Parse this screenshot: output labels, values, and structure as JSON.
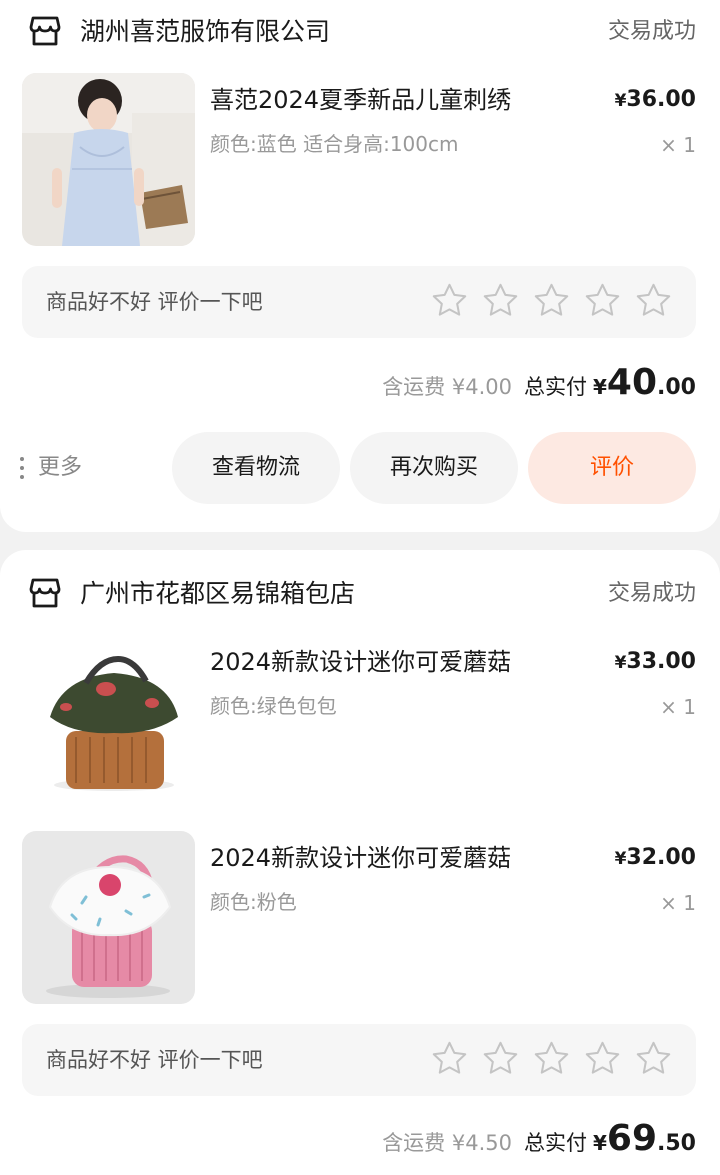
{
  "orders": [
    {
      "store_name": "湖州喜范服饰有限公司",
      "status": "交易成功",
      "products": [
        {
          "title": "喜范2024夏季新品儿童刺绣",
          "spec": "颜色:蓝色 适合身高:100cm",
          "price_symbol": "¥",
          "price": "36.00",
          "qty": "× 1",
          "image": "child-in-blue-dress-photo"
        }
      ],
      "review_prompt": "商品好不好 评价一下吧",
      "shipping_text": "含运费 ¥4.00",
      "total_label": "总实付",
      "total_symbol": "¥",
      "total_int": "40",
      "total_dec": ".00",
      "actions": {
        "more": "更多",
        "logistics": "查看物流",
        "rebuy": "再次购买",
        "review": "评价"
      }
    },
    {
      "store_name": "广州市花都区易锦箱包店",
      "status": "交易成功",
      "products": [
        {
          "title": "2024新款设计迷你可爱蘑菇",
          "spec": "颜色:绿色包包",
          "price_symbol": "¥",
          "price": "33.00",
          "qty": "× 1",
          "image": "green-mushroom-backpack-photo"
        },
        {
          "title": "2024新款设计迷你可爱蘑菇",
          "spec": "颜色:粉色",
          "price_symbol": "¥",
          "price": "32.00",
          "qty": "× 1",
          "image": "pink-mushroom-backpack-photo"
        }
      ],
      "review_prompt": "商品好不好 评价一下吧",
      "shipping_text": "含运费 ¥4.50",
      "total_label": "总实付",
      "total_symbol": "¥",
      "total_int": "69",
      "total_dec": ".50"
    }
  ],
  "colors": {
    "accent": "#ff5000",
    "review_button_bg": "#fde9e2",
    "page_bg": "#f2f2f2",
    "muted_text": "#999999"
  }
}
